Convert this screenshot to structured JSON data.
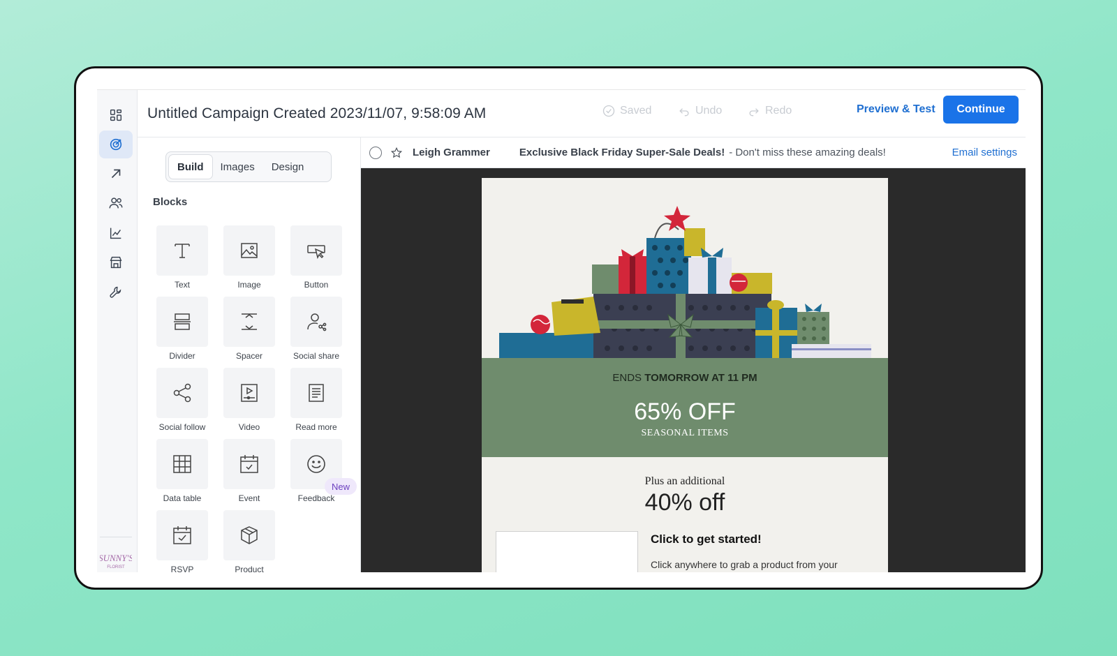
{
  "app": {
    "campaign_title": "Untitled Campaign Created 2023/11/07, 9:58:09 AM",
    "saved_label": "Saved",
    "undo_label": "Undo",
    "redo_label": "Redo",
    "preview_label": "Preview & Test",
    "continue_label": "Continue",
    "accent_color": "#1a73e8",
    "logo_text": "SUNNY'S"
  },
  "rail": {
    "items": [
      {
        "icon": "dashboard-icon"
      },
      {
        "icon": "campaigns-target-icon",
        "active": true
      },
      {
        "icon": "automations-arrow-icon"
      },
      {
        "icon": "audience-people-icon"
      },
      {
        "icon": "analytics-chart-icon"
      },
      {
        "icon": "store-icon"
      },
      {
        "icon": "integrations-wrench-icon"
      }
    ]
  },
  "builder": {
    "tabs": [
      "Build",
      "Images",
      "Design"
    ],
    "active_tab": "Build",
    "blocks_heading": "Blocks",
    "new_badge": "New",
    "blocks": [
      {
        "label": "Text",
        "icon": "text-icon"
      },
      {
        "label": "Image",
        "icon": "image-icon"
      },
      {
        "label": "Button",
        "icon": "button-icon"
      },
      {
        "label": "Divider",
        "icon": "divider-icon"
      },
      {
        "label": "Spacer",
        "icon": "spacer-icon"
      },
      {
        "label": "Social share",
        "icon": "social-share-icon"
      },
      {
        "label": "Social follow",
        "icon": "social-follow-icon"
      },
      {
        "label": "Video",
        "icon": "video-icon"
      },
      {
        "label": "Read more",
        "icon": "read-more-icon"
      },
      {
        "label": "Data table",
        "icon": "data-table-icon"
      },
      {
        "label": "Event",
        "icon": "event-icon"
      },
      {
        "label": "Feedback",
        "icon": "feedback-icon"
      },
      {
        "label": "RSVP",
        "icon": "rsvp-icon"
      },
      {
        "label": "Product",
        "icon": "product-icon"
      }
    ]
  },
  "email_header": {
    "sender": "Leigh Grammer",
    "subject": "Exclusive Black Friday Super-Sale Deals!",
    "preview_text": "- Don't miss these amazing deals!",
    "settings_link": "Email settings"
  },
  "email": {
    "ends_prefix": "ENDS ",
    "ends_bold": "TOMORROW AT 11 PM",
    "discount_main": "65% OFF",
    "discount_sub": "SEASONAL ITEMS",
    "additional_prefix": "Plus an additional",
    "additional_value": "40% off",
    "cta_title": "Click to get started!",
    "cta_body": "Click anywhere to grab a product from your",
    "band_color": "#6f8c6d"
  }
}
